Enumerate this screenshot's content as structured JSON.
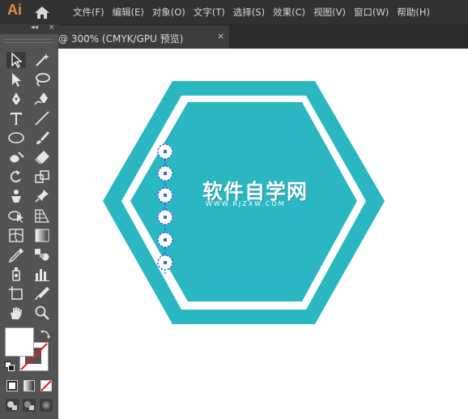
{
  "app": {
    "logo": "Ai"
  },
  "menu": [
    "文件(F)",
    "编辑(E)",
    "对象(O)",
    "文字(T)",
    "选择(S)",
    "效果(C)",
    "视图(V)",
    "窗口(W)",
    "帮助(H)"
  ],
  "document_tab": {
    "title": "@ 300% (CMYK/GPU 预览)",
    "close": "×"
  },
  "tool_panel": {
    "collapse": "◂◂",
    "close": "×",
    "tools": [
      "selection-tool",
      "magic-wand-tool",
      "direct-selection-tool",
      "lasso-tool",
      "pen-tool",
      "curvature-tool",
      "type-tool",
      "line-segment-tool",
      "ellipse-tool",
      "paintbrush-tool",
      "shaper-tool",
      "eraser-tool",
      "rotate-tool",
      "scale-tool",
      "puppet-warp-tool",
      "pin-tool",
      "shape-builder-tool",
      "perspective-grid-tool",
      "mesh-tool",
      "gradient-tool",
      "eyedropper-tool",
      "blend-tool",
      "symbol-sprayer-tool",
      "column-graph-tool",
      "artboard-tool",
      "slice-tool",
      "hand-tool",
      "zoom-tool"
    ],
    "active_tool": "selection-tool"
  },
  "colors": {
    "accent": "#2ab7c2",
    "selection": "#3a66e8",
    "fill": "#ffffff",
    "stroke": "none"
  },
  "artwork": {
    "title": "软件自学网",
    "url": "WWW.RJZXW.COM"
  }
}
